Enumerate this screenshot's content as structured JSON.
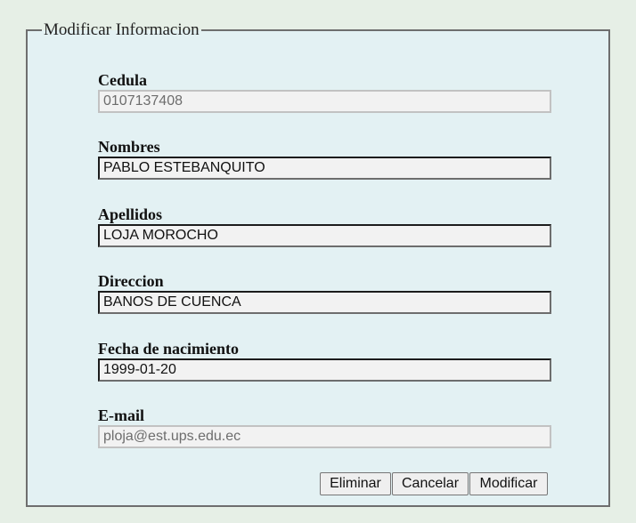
{
  "form": {
    "legend": "Modificar Informacion",
    "fields": [
      {
        "label": "Cedula",
        "value": "0107137408",
        "editable": false
      },
      {
        "label": "Nombres",
        "value": "PABLO ESTEBANQUITO",
        "editable": true
      },
      {
        "label": "Apellidos",
        "value": "LOJA MOROCHO",
        "editable": true
      },
      {
        "label": "Direccion",
        "value": "BANOS DE CUENCA",
        "editable": true
      },
      {
        "label": "Fecha de nacimiento",
        "value": "1999-01-20",
        "editable": true
      },
      {
        "label": "E-mail",
        "value": "ploja@est.ups.edu.ec",
        "editable": false
      }
    ],
    "buttons": {
      "delete": "Eliminar",
      "cancel": "Cancelar",
      "modify": "Modificar"
    }
  }
}
